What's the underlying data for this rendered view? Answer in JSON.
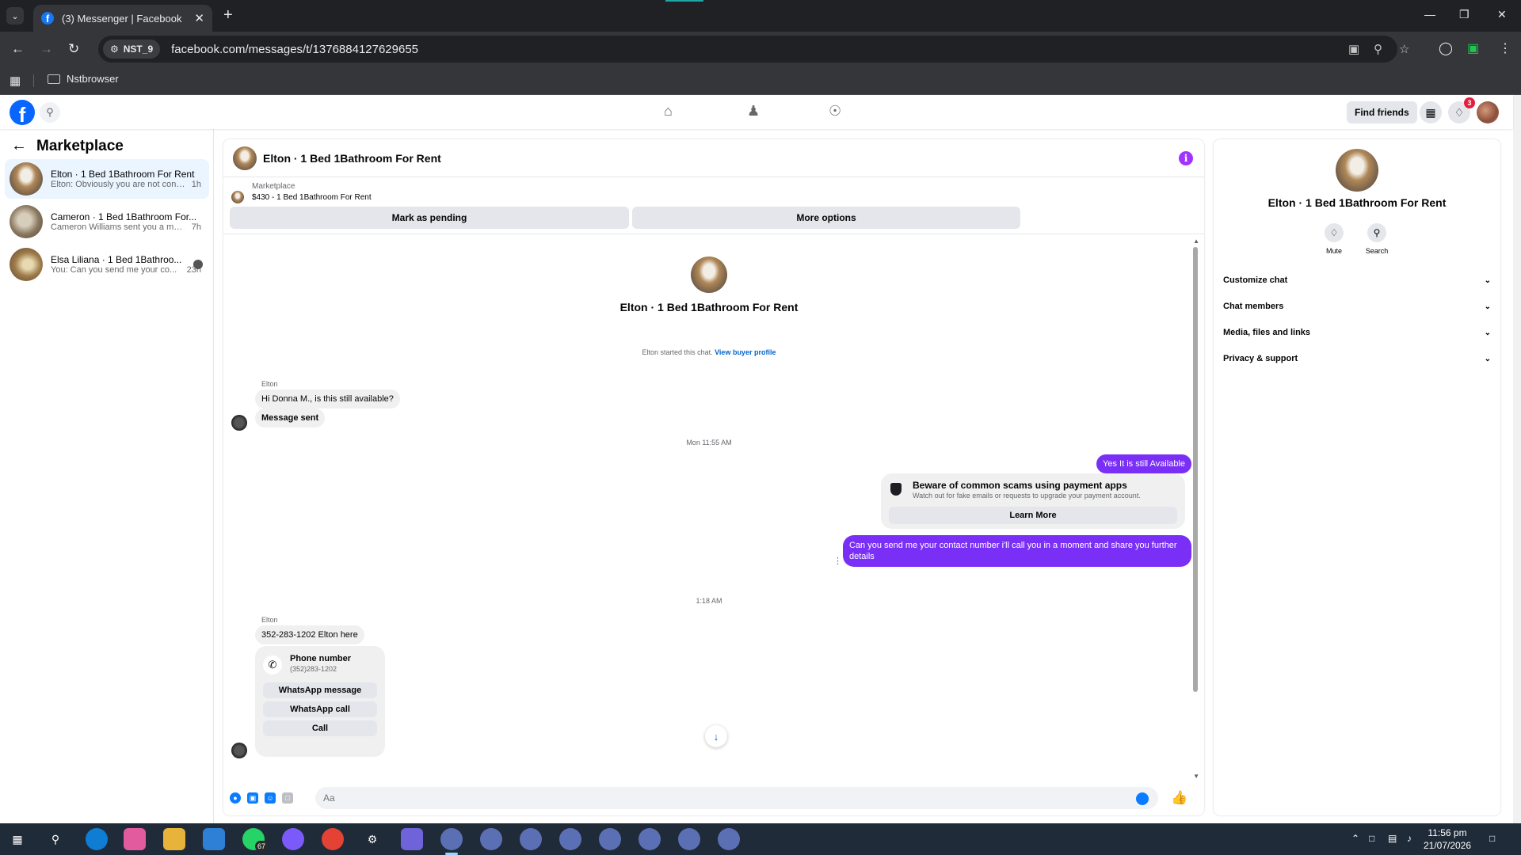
{
  "browser": {
    "tab_title": "(3) Messenger | Facebook",
    "url": "facebook.com/messages/t/1376884127629655",
    "profile_chip": "NST_9",
    "bookmark_folder": "Nstbrowser"
  },
  "fb_header": {
    "find_friends": "Find friends",
    "notification_count": "3"
  },
  "sidebar": {
    "title": "Marketplace",
    "conversations": [
      {
        "name": "Elton · 1 Bed 1Bathroom For Rent",
        "preview": "Elton: Obviously you are not conce...",
        "time": "1h"
      },
      {
        "name": "Cameron · 1 Bed 1Bathroom For...",
        "preview": "Cameron Williams sent you a mes...",
        "time": "7h"
      },
      {
        "name": "Elsa Liliana · 1 Bed 1Bathroo...",
        "preview": "You: Can you send me your co...",
        "time": "23h"
      }
    ]
  },
  "chat": {
    "title": "Elton · 1 Bed 1Bathroom For Rent",
    "marketplace_label": "Marketplace",
    "listing": "$430 - 1 Bed 1Bathroom For Rent",
    "mark_pending": "Mark as pending",
    "more_options": "More options",
    "intro_name": "Elton · 1 Bed 1Bathroom For Rent",
    "started_text": "Elton started this chat.",
    "view_profile": "View buyer profile",
    "sender_1": "Elton",
    "msg_in_1": "Hi Donna M., is this still available?",
    "msg_in_2": "Message sent",
    "time_1": "Mon 11:55 AM",
    "msg_out_1": "Yes It is still Available",
    "scam_title": "Beware of common scams using payment apps",
    "scam_sub": "Watch out for fake emails or requests to upgrade your payment account.",
    "learn_more": "Learn More",
    "msg_out_2": "Can you send me your contact number i'll call you in a moment and share you further details",
    "time_2": "1:18 AM",
    "sender_2": "Elton",
    "msg_in_3": "352-283-1202 Elton here",
    "phone_title": "Phone number",
    "phone_value": "(352)283-1202",
    "whatsapp_message": "WhatsApp message",
    "whatsapp_call": "WhatsApp call",
    "call": "Call",
    "composer_placeholder": "Aa"
  },
  "right_panel": {
    "name": "Elton · 1 Bed 1Bathroom For Rent",
    "mute": "Mute",
    "search": "Search",
    "sections": [
      "Customize chat",
      "Chat members",
      "Media, files and links",
      "Privacy & support"
    ]
  },
  "taskbar": {
    "whatsapp_badge": "67",
    "time": "11:56 pm",
    "date": "21/07/2026"
  },
  "colors": {
    "outgoing_bubble": "#7a2ff7",
    "fb_blue": "#0866ff",
    "info_icon": "#a033ff"
  }
}
